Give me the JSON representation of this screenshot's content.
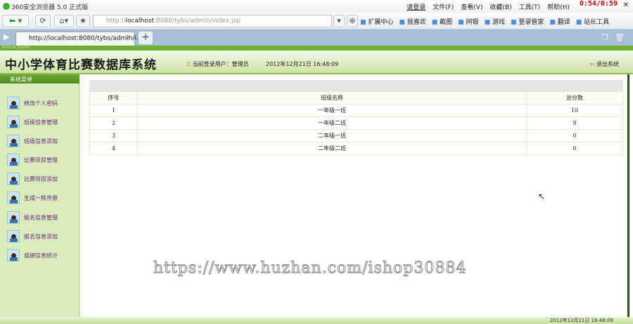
{
  "browser": {
    "title": "360安全浏览器 5.0 正式版",
    "login": "请登录",
    "menus": [
      "文件(F)",
      "查看(V)",
      "收藏(B)",
      "工具(T)",
      "帮助(H)"
    ],
    "clock": "0:54/0:59",
    "url_prefix": "http://",
    "url_host": "localhost",
    "url_rest": ":8080/tybs/admin/index.jsp",
    "toolbar": [
      "扩展中心",
      "我喜欢",
      "截图",
      "网银",
      "游戏",
      "登录管家",
      "翻译",
      "站长工具"
    ],
    "tab_title": "http://localhost:8080/tybs/admin/i..."
  },
  "strip_text": "Intranet System",
  "header": {
    "title": "中小学体育比赛数据库系统",
    "user_label": "当前登录用户：管理员",
    "datetime": "2012年12月21日  16:48:09",
    "logout": "退出系统"
  },
  "sidebar": {
    "title": "系统菜单",
    "items": [
      "修改个人密码",
      "班级信息管理",
      "班级信息添加",
      "比赛项目管理",
      "比赛项目添加",
      "生成一秩序册",
      "报名信息管理",
      "报名信息添加",
      "成绩信息统计"
    ]
  },
  "table": {
    "headers": [
      "序号",
      "班级名称",
      "总分数"
    ],
    "rows": [
      [
        "1",
        "一年级一班",
        "10"
      ],
      [
        "2",
        "一年级二班",
        "9"
      ],
      [
        "3",
        "二年级一班",
        "0"
      ],
      [
        "4",
        "二年级二班",
        "0"
      ]
    ]
  },
  "watermark": "https://www.huzhan.com/ishop30884",
  "footer": "2012年12月21日  16:48:09"
}
